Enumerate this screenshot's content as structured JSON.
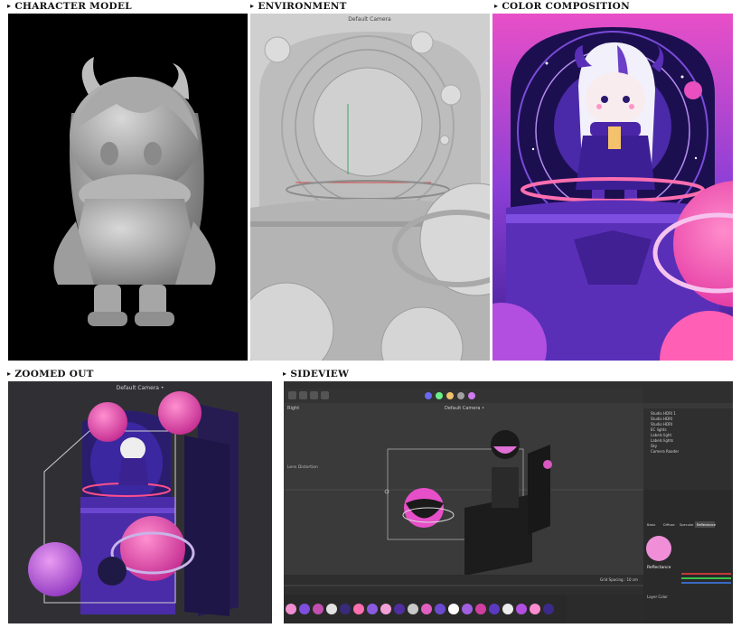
{
  "captions": {
    "character_model": "CHARACTER MODEL",
    "environment": "ENVIRONMENT",
    "color_composition": "COLOR COMPOSITION",
    "zoomed_out": "ZOOMED OUT",
    "sideview": "SIDEVIEW"
  },
  "arrow_glyph": "▸",
  "zoomed_out_viewport": {
    "camera_label": "Default Camera •"
  },
  "environment_viewport": {
    "camera_label": "Default Camera"
  },
  "sideview_app": {
    "viewport_label": "Right",
    "camera_label": "Default Camera •",
    "left_label": "Lens Distortion",
    "grid_label": "Grid Spacing : 10 cm",
    "object_panel_items": [
      "Studio HDRI 1",
      "Studio HDRI",
      "Studio HDRI",
      "EC lights",
      "Labels light",
      "Labels lights",
      "Sky",
      "Camera Rooder"
    ],
    "attr_tabs": [
      "Basic",
      "Diffuse",
      "Specular",
      "Reflectance",
      "Illumination"
    ],
    "attr_title": "Reflectance",
    "layer_label": "Layer Color"
  },
  "colors": {
    "purple_dark": "#2a1a6e",
    "purple_mid": "#5a2fb8",
    "magenta": "#e94fbf",
    "pink": "#ff5fb4",
    "lavender": "#b58cf0",
    "viewport_gray": "#c8c8c8",
    "c4d_dark": "#2b2b2b"
  }
}
